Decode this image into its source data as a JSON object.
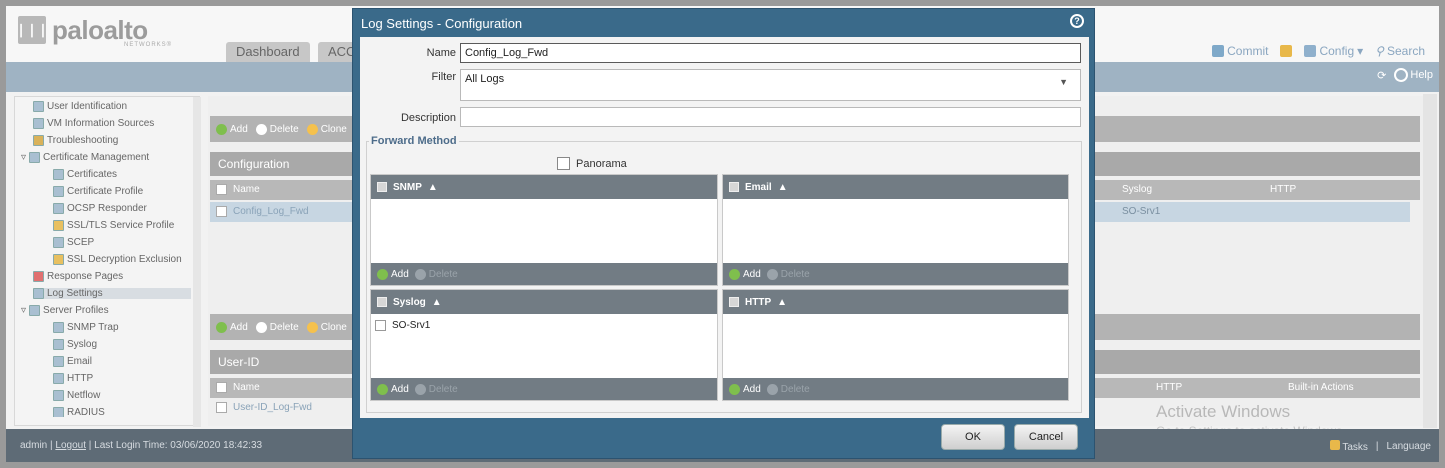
{
  "brand": {
    "name": "paloalto",
    "sub": "NETWORKS®",
    "mark": "❘❘❘"
  },
  "tabs": [
    "Dashboard",
    "ACC"
  ],
  "top_actions": {
    "commit": "Commit",
    "config": "Config",
    "search": "Search",
    "help": "Help"
  },
  "sidebar": {
    "items": [
      "User Identification",
      "VM Information Sources",
      "Troubleshooting",
      "Certificate Management",
      "Certificates",
      "Certificate Profile",
      "OCSP Responder",
      "SSL/TLS Service Profile",
      "SCEP",
      "SSL Decryption Exclusion",
      "Response Pages",
      "Log Settings",
      "Server Profiles",
      "SNMP Trap",
      "Syslog",
      "Email",
      "HTTP",
      "Netflow",
      "RADIUS"
    ]
  },
  "content": {
    "toolbar1": {
      "add": "Add",
      "delete": "Delete",
      "clone": "Clone"
    },
    "config_section": "Configuration",
    "config_cols": {
      "name": "Name",
      "syslog": "Syslog",
      "http": "HTTP"
    },
    "config_row": {
      "name": "Config_Log_Fwd",
      "syslog": "SO-Srv1"
    },
    "toolbar2": {
      "add": "Add",
      "delete": "Delete",
      "clone": "Clone"
    },
    "userid_section": "User-ID",
    "userid_cols": {
      "name": "Name",
      "http": "HTTP",
      "builtin": "Built-in Actions"
    },
    "userid_row": {
      "name": "User-ID_Log-Fwd"
    }
  },
  "watermark": {
    "line1": "Activate Windows",
    "line2": "Go to Settings to activate Windows."
  },
  "footer": {
    "user": "admin",
    "logout": "Logout",
    "last_login": "Last Login Time: 03/06/2020 18:42:33",
    "tasks": "Tasks",
    "language": "Language"
  },
  "modal": {
    "title": "Log Settings - Configuration",
    "name_label": "Name",
    "name_value": "Config_Log_Fwd",
    "filter_label": "Filter",
    "filter_value": "All Logs",
    "description_label": "Description",
    "description_value": "",
    "forward_method": "Forward Method",
    "panorama_label": "Panorama",
    "grids": {
      "snmp": {
        "title": "SNMP",
        "rows": [],
        "add": "Add",
        "delete": "Delete"
      },
      "email": {
        "title": "Email",
        "rows": [],
        "add": "Add",
        "delete": "Delete"
      },
      "syslog": {
        "title": "Syslog",
        "rows": [
          "SO-Srv1"
        ],
        "add": "Add",
        "delete": "Delete"
      },
      "http": {
        "title": "HTTP",
        "rows": [],
        "add": "Add",
        "delete": "Delete"
      }
    },
    "ok": "OK",
    "cancel": "Cancel"
  },
  "colors": {
    "modal_header": "#3a6a8a",
    "grid_header": "#727c84",
    "add_icon": "#7fbf4d"
  }
}
